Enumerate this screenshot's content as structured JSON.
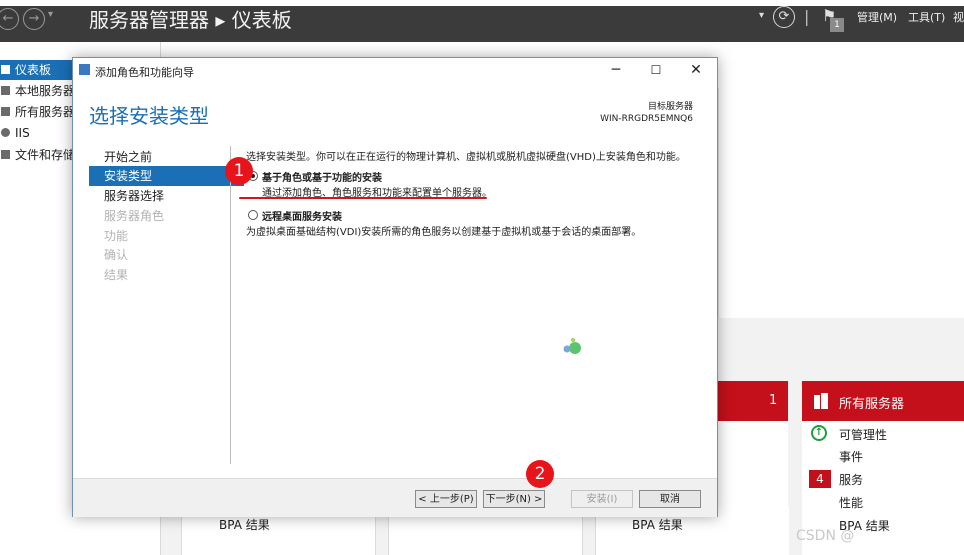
{
  "server_manager": {
    "title": "服务器管理器 ▸ 仪表板",
    "notification_count": "1",
    "menus": [
      "管理(M)",
      "工具(T)",
      "视"
    ],
    "sidebar": [
      {
        "label": "仪表板",
        "active": true
      },
      {
        "label": "本地服务器",
        "active": false
      },
      {
        "label": "所有服务器",
        "active": false
      },
      {
        "label": "IIS",
        "active": false
      },
      {
        "label": "文件和存储",
        "active": false
      }
    ],
    "tiles": {
      "partial_count": "1",
      "all_servers": {
        "title": "所有服务器",
        "rows": [
          "可管理性",
          "事件",
          "服务",
          "性能",
          "BPA 结果"
        ],
        "services_badge": "4"
      },
      "bottom_bpa": [
        "BPA 结果",
        "BPA 结果"
      ]
    }
  },
  "dialog": {
    "window_title": "添加角色和功能向导",
    "heading": "选择安装类型",
    "destination_label": "目标服务器",
    "destination_server": "WIN-RRGDR5EMNQ6",
    "steps": [
      {
        "label": "开始之前",
        "state": "done"
      },
      {
        "label": "安装类型",
        "state": "current"
      },
      {
        "label": "服务器选择",
        "state": "next"
      },
      {
        "label": "服务器角色",
        "state": "disabled"
      },
      {
        "label": "功能",
        "state": "disabled"
      },
      {
        "label": "确认",
        "state": "disabled"
      },
      {
        "label": "结果",
        "state": "disabled"
      }
    ],
    "description": "选择安装类型。你可以在正在运行的物理计算机、虚拟机或脱机虚拟硬盘(VHD)上安装角色和功能。",
    "options": [
      {
        "title": "基于角色或基于功能的安装",
        "desc": "通过添加角色、角色服务和功能来配置单个服务器。",
        "selected": true
      },
      {
        "title": "远程桌面服务安装",
        "desc": "为虚拟桌面基础结构(VDI)安装所需的角色服务以创建基于虚拟机或基于会话的桌面部署。",
        "selected": false
      }
    ],
    "buttons": {
      "prev": "< 上一步(P)",
      "next": "下一步(N) >",
      "install": "安装(I)",
      "cancel": "取消"
    }
  },
  "annotations": {
    "badge1": "1",
    "badge2": "2"
  },
  "watermark": "CSDN @",
  "colors": {
    "accent_blue": "#1a6fb5",
    "tile_red": "#c4101a",
    "badge_red": "#e8141b"
  }
}
